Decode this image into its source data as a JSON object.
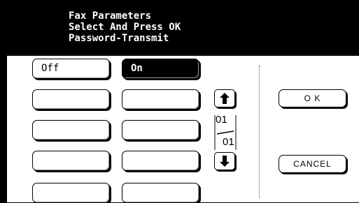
{
  "header": {
    "line1": "Fax Parameters",
    "line2": "Select And Press OK",
    "line3": "Password-Transmit"
  },
  "options": {
    "off_label": "Off",
    "on_label": "On",
    "selected": "On"
  },
  "pager": {
    "current": "01",
    "total": "01",
    "up_icon": "arrow-up-icon",
    "down_icon": "arrow-down-icon"
  },
  "actions": {
    "ok_label": "O K",
    "cancel_label": "CANCEL"
  }
}
